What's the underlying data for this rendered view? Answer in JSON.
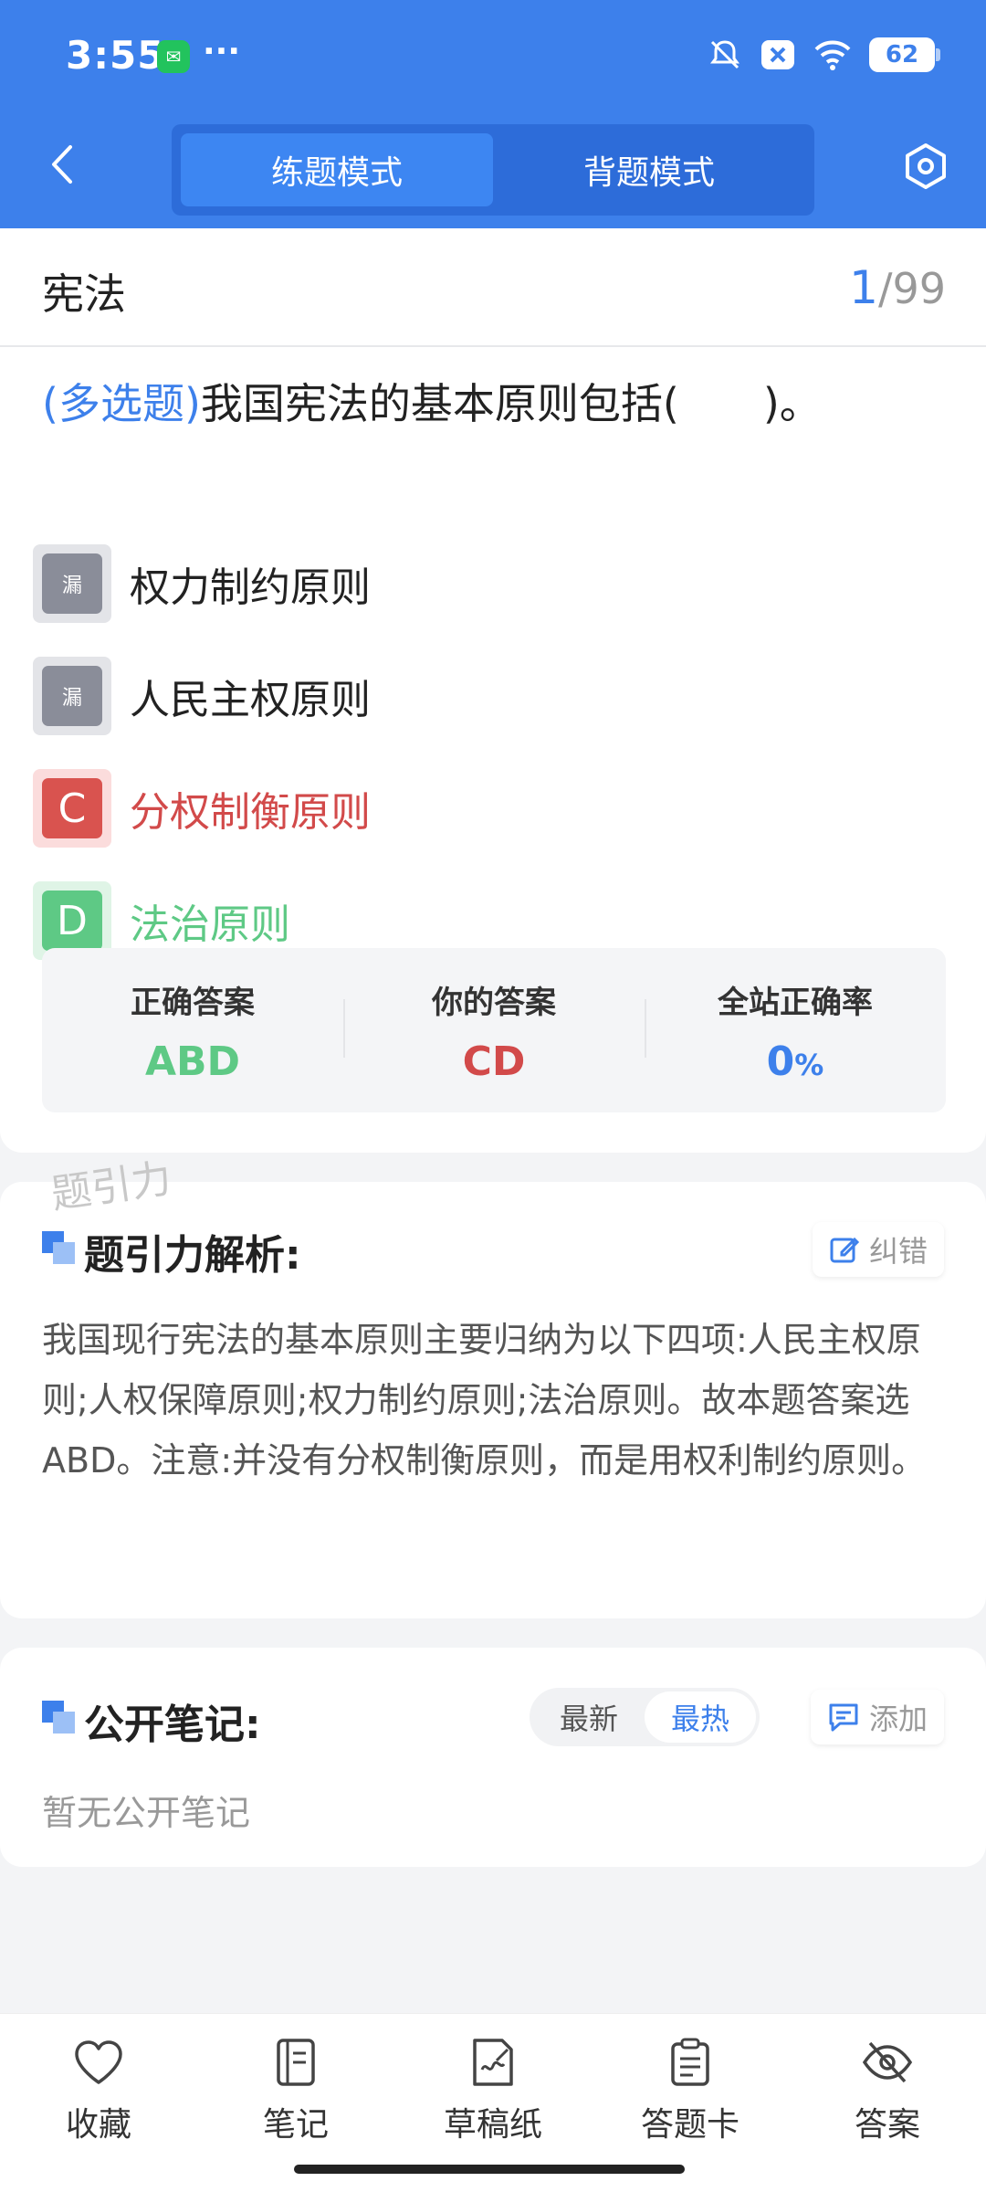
{
  "status_bar": {
    "time": "3:55",
    "more": "···",
    "battery": "62"
  },
  "nav": {
    "mode_tabs": [
      {
        "label": "练题模式",
        "active": true
      },
      {
        "label": "背题模式",
        "active": false
      }
    ]
  },
  "question_card": {
    "subject": "宪法",
    "counter": {
      "current": "1",
      "total": "99"
    },
    "question": {
      "type": "(多选题)",
      "text": "我国宪法的基本原则包括(　　)。"
    },
    "options": [
      {
        "badge": "漏",
        "text": "权力制约原则",
        "state": "missed"
      },
      {
        "badge": "漏",
        "text": "人民主权原则",
        "state": "missed"
      },
      {
        "badge": "C",
        "text": "分权制衡原则",
        "state": "wrong"
      },
      {
        "badge": "D",
        "text": "法治原则",
        "state": "correct"
      }
    ],
    "answers": {
      "correct_label": "正确答案",
      "correct_value": "ABD",
      "yours_label": "你的答案",
      "yours_value": "CD",
      "rate_label": "全站正确率",
      "rate_value": "0",
      "rate_unit": "%"
    }
  },
  "watermark": "题引力",
  "analysis": {
    "title": "题引力解析:",
    "report_label": "纠错",
    "text": "我国现行宪法的基本原则主要归纳为以下四项:人民主权原则;人权保障原则;权力制约原则;法治原则。故本题答案选ABD。注意:并没有分权制衡原则，而是用权利制约原则。"
  },
  "notes": {
    "title": "公开笔记:",
    "sort_tabs": [
      {
        "label": "最新",
        "active": false
      },
      {
        "label": "最热",
        "active": true
      }
    ],
    "add_label": "添加",
    "empty_text": "暂无公开笔记"
  },
  "bottom_bar": {
    "items": [
      {
        "label": "收藏",
        "icon": "heart-icon"
      },
      {
        "label": "笔记",
        "icon": "notebook-icon"
      },
      {
        "label": "草稿纸",
        "icon": "draft-paper-icon"
      },
      {
        "label": "答题卡",
        "icon": "answer-sheet-icon"
      },
      {
        "label": "答案",
        "icon": "eye-off-icon"
      }
    ]
  },
  "colors": {
    "brand": "#3d80eb",
    "wrong": "#d24a4a",
    "correct": "#5ec985",
    "missed": "#8a8d99"
  }
}
